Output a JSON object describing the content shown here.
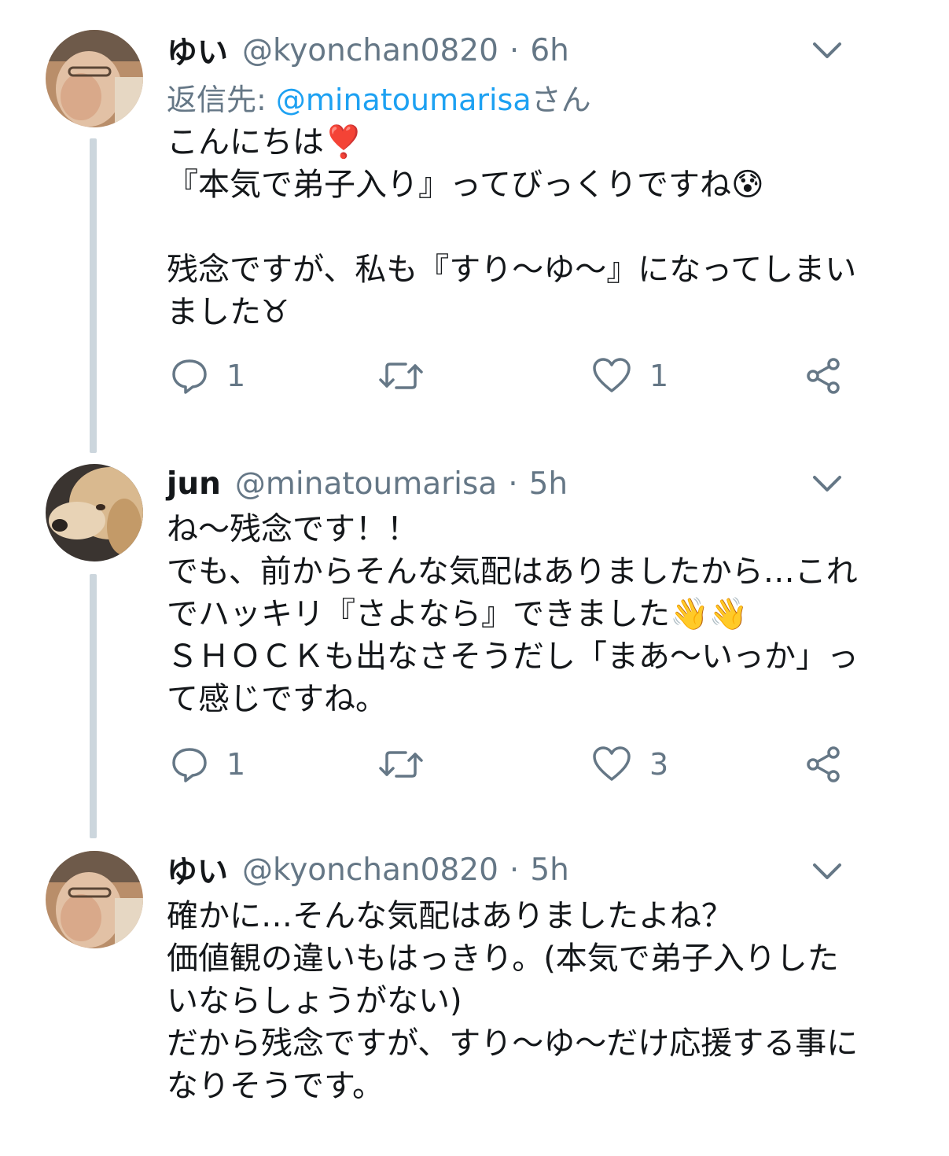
{
  "tweets": [
    {
      "name": "ゆい",
      "handle": "@kyonchan0820",
      "separator": "·",
      "time": "6h",
      "reply_prefix": "返信先: ",
      "reply_mention": "@minatoumarisa",
      "reply_suffix": "さん",
      "body": "こんにちは❣️\n『本気で弟子入り』ってびっくりですね😰\n\n残念ですが、私も『すり〜ゆ〜』になってしまいました♉",
      "reply_count": "1",
      "like_count": "1"
    },
    {
      "name": "jun",
      "handle": "@minatoumarisa",
      "separator": "·",
      "time": "5h",
      "body": "ね〜残念です！！\nでも、前からそんな気配はありましたから…これでハッキリ『さよなら』できました👋👋\nＳＨＯＣＫも出なさそうだし「まあ〜いっか」って感じですね。",
      "reply_count": "1",
      "like_count": "3"
    },
    {
      "name": "ゆい",
      "handle": "@kyonchan0820",
      "separator": "·",
      "time": "5h",
      "body": "確かに…そんな気配はありましたよね？\n価値観の違いもはっきり。(本気で弟子入りしたいならしょうがない)\nだから残念ですが、すり〜ゆ〜だけ応援する事になりそうです。"
    }
  ],
  "icons": {
    "reply": "speech-bubble-icon",
    "retweet": "retweet-arrows-icon",
    "like": "heart-icon",
    "share": "share-nodes-icon",
    "menu": "chevron-down-icon"
  },
  "colors": {
    "text": "#14171a",
    "secondary": "#657786",
    "link": "#1da1f2",
    "thread_line": "#ccd6dd"
  }
}
